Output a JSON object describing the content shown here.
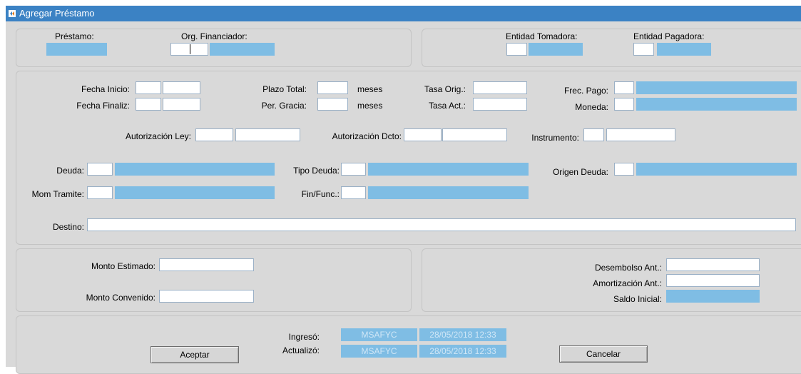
{
  "window": {
    "title": "Agregar Préstamo"
  },
  "header": {
    "prestamo_label": "Préstamo:",
    "org_financiador_label": "Org. Financiador:",
    "entidad_tomadora_label": "Entidad Tomadora:",
    "entidad_pagadora_label": "Entidad Pagadora:"
  },
  "details": {
    "fecha_inicio_label": "Fecha Inicio:",
    "fecha_finaliz_label": "Fecha Finaliz:",
    "plazo_total_label": "Plazo Total:",
    "per_gracia_label": "Per. Gracia:",
    "meses_1": "meses",
    "meses_2": "meses",
    "tasa_orig_label": "Tasa Orig.:",
    "tasa_act_label": "Tasa Act.:",
    "frec_pago_label": "Frec. Pago:",
    "moneda_label": "Moneda:",
    "autorizacion_ley_label": "Autorización Ley:",
    "autorizacion_dcto_label": "Autorización Dcto:",
    "instrumento_label": "Instrumento:",
    "deuda_label": "Deuda:",
    "tipo_deuda_label": "Tipo Deuda:",
    "origen_deuda_label": "Origen Deuda:",
    "mom_tramite_label": "Mom Tramite:",
    "fin_func_label": "Fin/Func.:",
    "destino_label": "Destino:"
  },
  "amounts": {
    "monto_estimado_label": "Monto Estimado:",
    "monto_convenido_label": "Monto Convenido:",
    "desembolso_ant_label": "Desembolso Ant.:",
    "amortizacion_ant_label": "Amortización Ant.:",
    "saldo_inicial_label": "Saldo Inicial:"
  },
  "footer": {
    "ingreso_label": "Ingresó:",
    "actualizo_label": "Actualizó:",
    "ingreso_user": "MSAFYC",
    "ingreso_date": "28/05/2018 12:33",
    "actualizo_user": "MSAFYC",
    "actualizo_date": "28/05/2018 12:33",
    "aceptar_label": "Aceptar",
    "cancelar_label": "Cancelar"
  },
  "colors": {
    "titlebar": "#3b82c4",
    "readonly_field": "#7fbde4",
    "background": "#d9d9d9"
  },
  "icons": {
    "window": "app-window-icon"
  }
}
